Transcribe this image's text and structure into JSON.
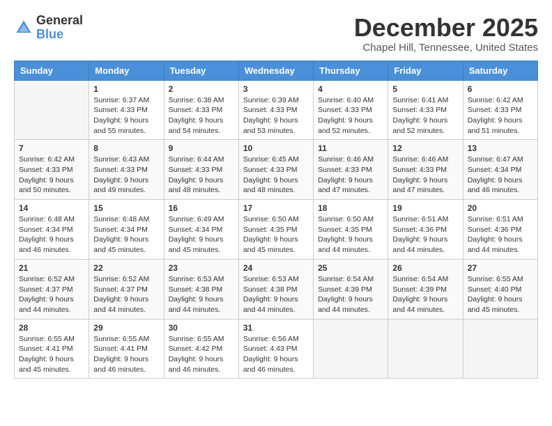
{
  "header": {
    "logo_general": "General",
    "logo_blue": "Blue",
    "month_title": "December 2025",
    "location": "Chapel Hill, Tennessee, United States"
  },
  "days_of_week": [
    "Sunday",
    "Monday",
    "Tuesday",
    "Wednesday",
    "Thursday",
    "Friday",
    "Saturday"
  ],
  "weeks": [
    [
      {
        "day": "",
        "sunrise": "",
        "sunset": "",
        "daylight": ""
      },
      {
        "day": "1",
        "sunrise": "Sunrise: 6:37 AM",
        "sunset": "Sunset: 4:33 PM",
        "daylight": "Daylight: 9 hours and 55 minutes."
      },
      {
        "day": "2",
        "sunrise": "Sunrise: 6:38 AM",
        "sunset": "Sunset: 4:33 PM",
        "daylight": "Daylight: 9 hours and 54 minutes."
      },
      {
        "day": "3",
        "sunrise": "Sunrise: 6:39 AM",
        "sunset": "Sunset: 4:33 PM",
        "daylight": "Daylight: 9 hours and 53 minutes."
      },
      {
        "day": "4",
        "sunrise": "Sunrise: 6:40 AM",
        "sunset": "Sunset: 4:33 PM",
        "daylight": "Daylight: 9 hours and 52 minutes."
      },
      {
        "day": "5",
        "sunrise": "Sunrise: 6:41 AM",
        "sunset": "Sunset: 4:33 PM",
        "daylight": "Daylight: 9 hours and 52 minutes."
      },
      {
        "day": "6",
        "sunrise": "Sunrise: 6:42 AM",
        "sunset": "Sunset: 4:33 PM",
        "daylight": "Daylight: 9 hours and 51 minutes."
      }
    ],
    [
      {
        "day": "7",
        "sunrise": "Sunrise: 6:42 AM",
        "sunset": "Sunset: 4:33 PM",
        "daylight": "Daylight: 9 hours and 50 minutes."
      },
      {
        "day": "8",
        "sunrise": "Sunrise: 6:43 AM",
        "sunset": "Sunset: 4:33 PM",
        "daylight": "Daylight: 9 hours and 49 minutes."
      },
      {
        "day": "9",
        "sunrise": "Sunrise: 6:44 AM",
        "sunset": "Sunset: 4:33 PM",
        "daylight": "Daylight: 9 hours and 48 minutes."
      },
      {
        "day": "10",
        "sunrise": "Sunrise: 6:45 AM",
        "sunset": "Sunset: 4:33 PM",
        "daylight": "Daylight: 9 hours and 48 minutes."
      },
      {
        "day": "11",
        "sunrise": "Sunrise: 6:46 AM",
        "sunset": "Sunset: 4:33 PM",
        "daylight": "Daylight: 9 hours and 47 minutes."
      },
      {
        "day": "12",
        "sunrise": "Sunrise: 6:46 AM",
        "sunset": "Sunset: 4:33 PM",
        "daylight": "Daylight: 9 hours and 47 minutes."
      },
      {
        "day": "13",
        "sunrise": "Sunrise: 6:47 AM",
        "sunset": "Sunset: 4:34 PM",
        "daylight": "Daylight: 9 hours and 46 minutes."
      }
    ],
    [
      {
        "day": "14",
        "sunrise": "Sunrise: 6:48 AM",
        "sunset": "Sunset: 4:34 PM",
        "daylight": "Daylight: 9 hours and 46 minutes."
      },
      {
        "day": "15",
        "sunrise": "Sunrise: 6:48 AM",
        "sunset": "Sunset: 4:34 PM",
        "daylight": "Daylight: 9 hours and 45 minutes."
      },
      {
        "day": "16",
        "sunrise": "Sunrise: 6:49 AM",
        "sunset": "Sunset: 4:34 PM",
        "daylight": "Daylight: 9 hours and 45 minutes."
      },
      {
        "day": "17",
        "sunrise": "Sunrise: 6:50 AM",
        "sunset": "Sunset: 4:35 PM",
        "daylight": "Daylight: 9 hours and 45 minutes."
      },
      {
        "day": "18",
        "sunrise": "Sunrise: 6:50 AM",
        "sunset": "Sunset: 4:35 PM",
        "daylight": "Daylight: 9 hours and 44 minutes."
      },
      {
        "day": "19",
        "sunrise": "Sunrise: 6:51 AM",
        "sunset": "Sunset: 4:36 PM",
        "daylight": "Daylight: 9 hours and 44 minutes."
      },
      {
        "day": "20",
        "sunrise": "Sunrise: 6:51 AM",
        "sunset": "Sunset: 4:36 PM",
        "daylight": "Daylight: 9 hours and 44 minutes."
      }
    ],
    [
      {
        "day": "21",
        "sunrise": "Sunrise: 6:52 AM",
        "sunset": "Sunset: 4:37 PM",
        "daylight": "Daylight: 9 hours and 44 minutes."
      },
      {
        "day": "22",
        "sunrise": "Sunrise: 6:52 AM",
        "sunset": "Sunset: 4:37 PM",
        "daylight": "Daylight: 9 hours and 44 minutes."
      },
      {
        "day": "23",
        "sunrise": "Sunrise: 6:53 AM",
        "sunset": "Sunset: 4:38 PM",
        "daylight": "Daylight: 9 hours and 44 minutes."
      },
      {
        "day": "24",
        "sunrise": "Sunrise: 6:53 AM",
        "sunset": "Sunset: 4:38 PM",
        "daylight": "Daylight: 9 hours and 44 minutes."
      },
      {
        "day": "25",
        "sunrise": "Sunrise: 6:54 AM",
        "sunset": "Sunset: 4:39 PM",
        "daylight": "Daylight: 9 hours and 44 minutes."
      },
      {
        "day": "26",
        "sunrise": "Sunrise: 6:54 AM",
        "sunset": "Sunset: 4:39 PM",
        "daylight": "Daylight: 9 hours and 44 minutes."
      },
      {
        "day": "27",
        "sunrise": "Sunrise: 6:55 AM",
        "sunset": "Sunset: 4:40 PM",
        "daylight": "Daylight: 9 hours and 45 minutes."
      }
    ],
    [
      {
        "day": "28",
        "sunrise": "Sunrise: 6:55 AM",
        "sunset": "Sunset: 4:41 PM",
        "daylight": "Daylight: 9 hours and 45 minutes."
      },
      {
        "day": "29",
        "sunrise": "Sunrise: 6:55 AM",
        "sunset": "Sunset: 4:41 PM",
        "daylight": "Daylight: 9 hours and 46 minutes."
      },
      {
        "day": "30",
        "sunrise": "Sunrise: 6:55 AM",
        "sunset": "Sunset: 4:42 PM",
        "daylight": "Daylight: 9 hours and 46 minutes."
      },
      {
        "day": "31",
        "sunrise": "Sunrise: 6:56 AM",
        "sunset": "Sunset: 4:43 PM",
        "daylight": "Daylight: 9 hours and 46 minutes."
      },
      {
        "day": "",
        "sunrise": "",
        "sunset": "",
        "daylight": ""
      },
      {
        "day": "",
        "sunrise": "",
        "sunset": "",
        "daylight": ""
      },
      {
        "day": "",
        "sunrise": "",
        "sunset": "",
        "daylight": ""
      }
    ]
  ]
}
